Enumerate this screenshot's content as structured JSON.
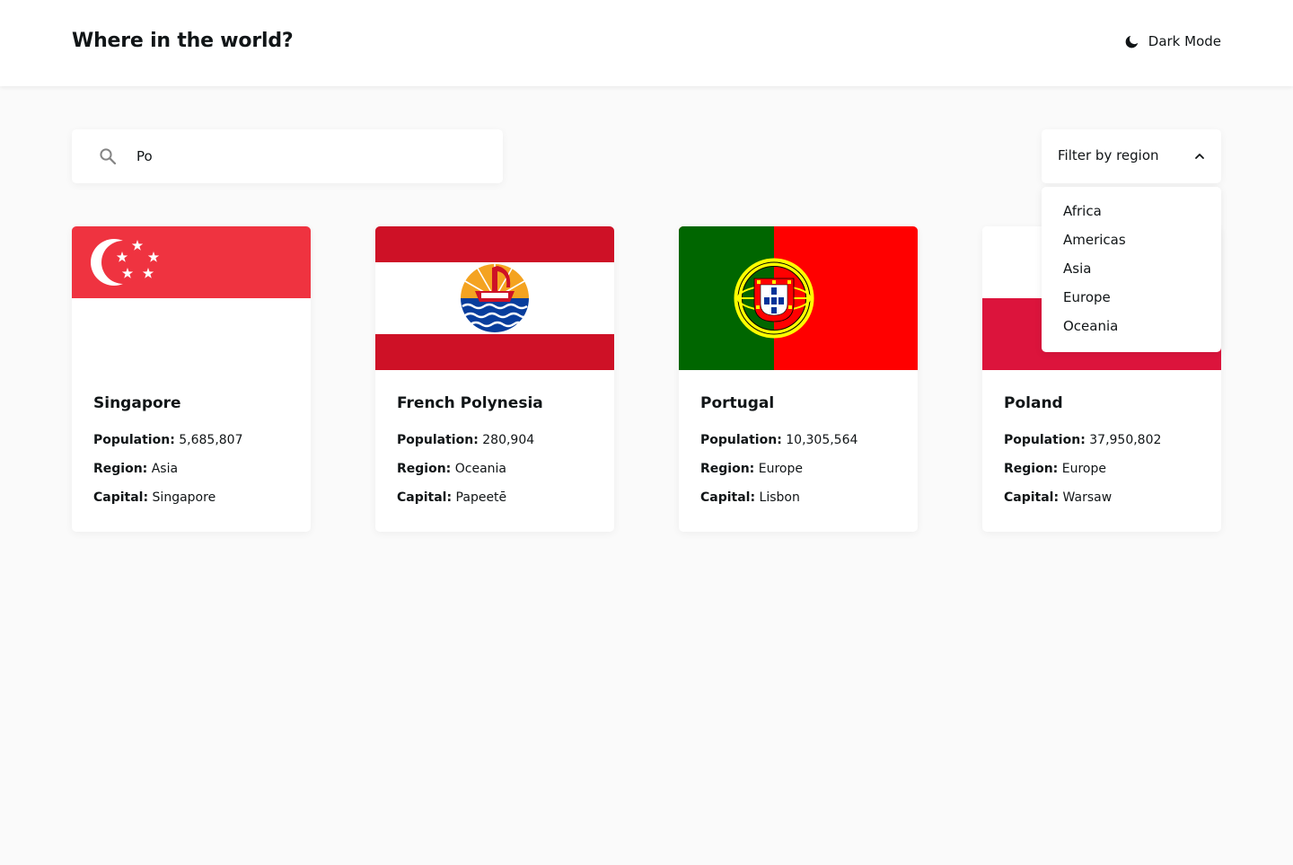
{
  "header": {
    "title": "Where in the world?",
    "theme_toggle_label": "Dark Mode",
    "theme_icon": "moon-icon"
  },
  "search": {
    "value": "Po",
    "icon": "search-icon"
  },
  "filter": {
    "label": "Filter by region",
    "icon": "chevron-up-icon",
    "expanded": true,
    "options": [
      "Africa",
      "Americas",
      "Asia",
      "Europe",
      "Oceania"
    ]
  },
  "field_labels": {
    "population": "Population:",
    "region": "Region:",
    "capital": "Capital:"
  },
  "countries": [
    {
      "name": "Singapore",
      "population": "5,685,807",
      "region": "Asia",
      "capital": "Singapore",
      "flag": "singapore-flag"
    },
    {
      "name": "French Polynesia",
      "population": "280,904",
      "region": "Oceania",
      "capital": "Papeetē",
      "flag": "french-polynesia-flag"
    },
    {
      "name": "Portugal",
      "population": "10,305,564",
      "region": "Europe",
      "capital": "Lisbon",
      "flag": "portugal-flag"
    },
    {
      "name": "Poland",
      "population": "37,950,802",
      "region": "Europe",
      "capital": "Warsaw",
      "flag": "poland-flag"
    }
  ],
  "colors": {
    "background": "#fafafa",
    "surface": "#ffffff",
    "text": "#111517"
  }
}
